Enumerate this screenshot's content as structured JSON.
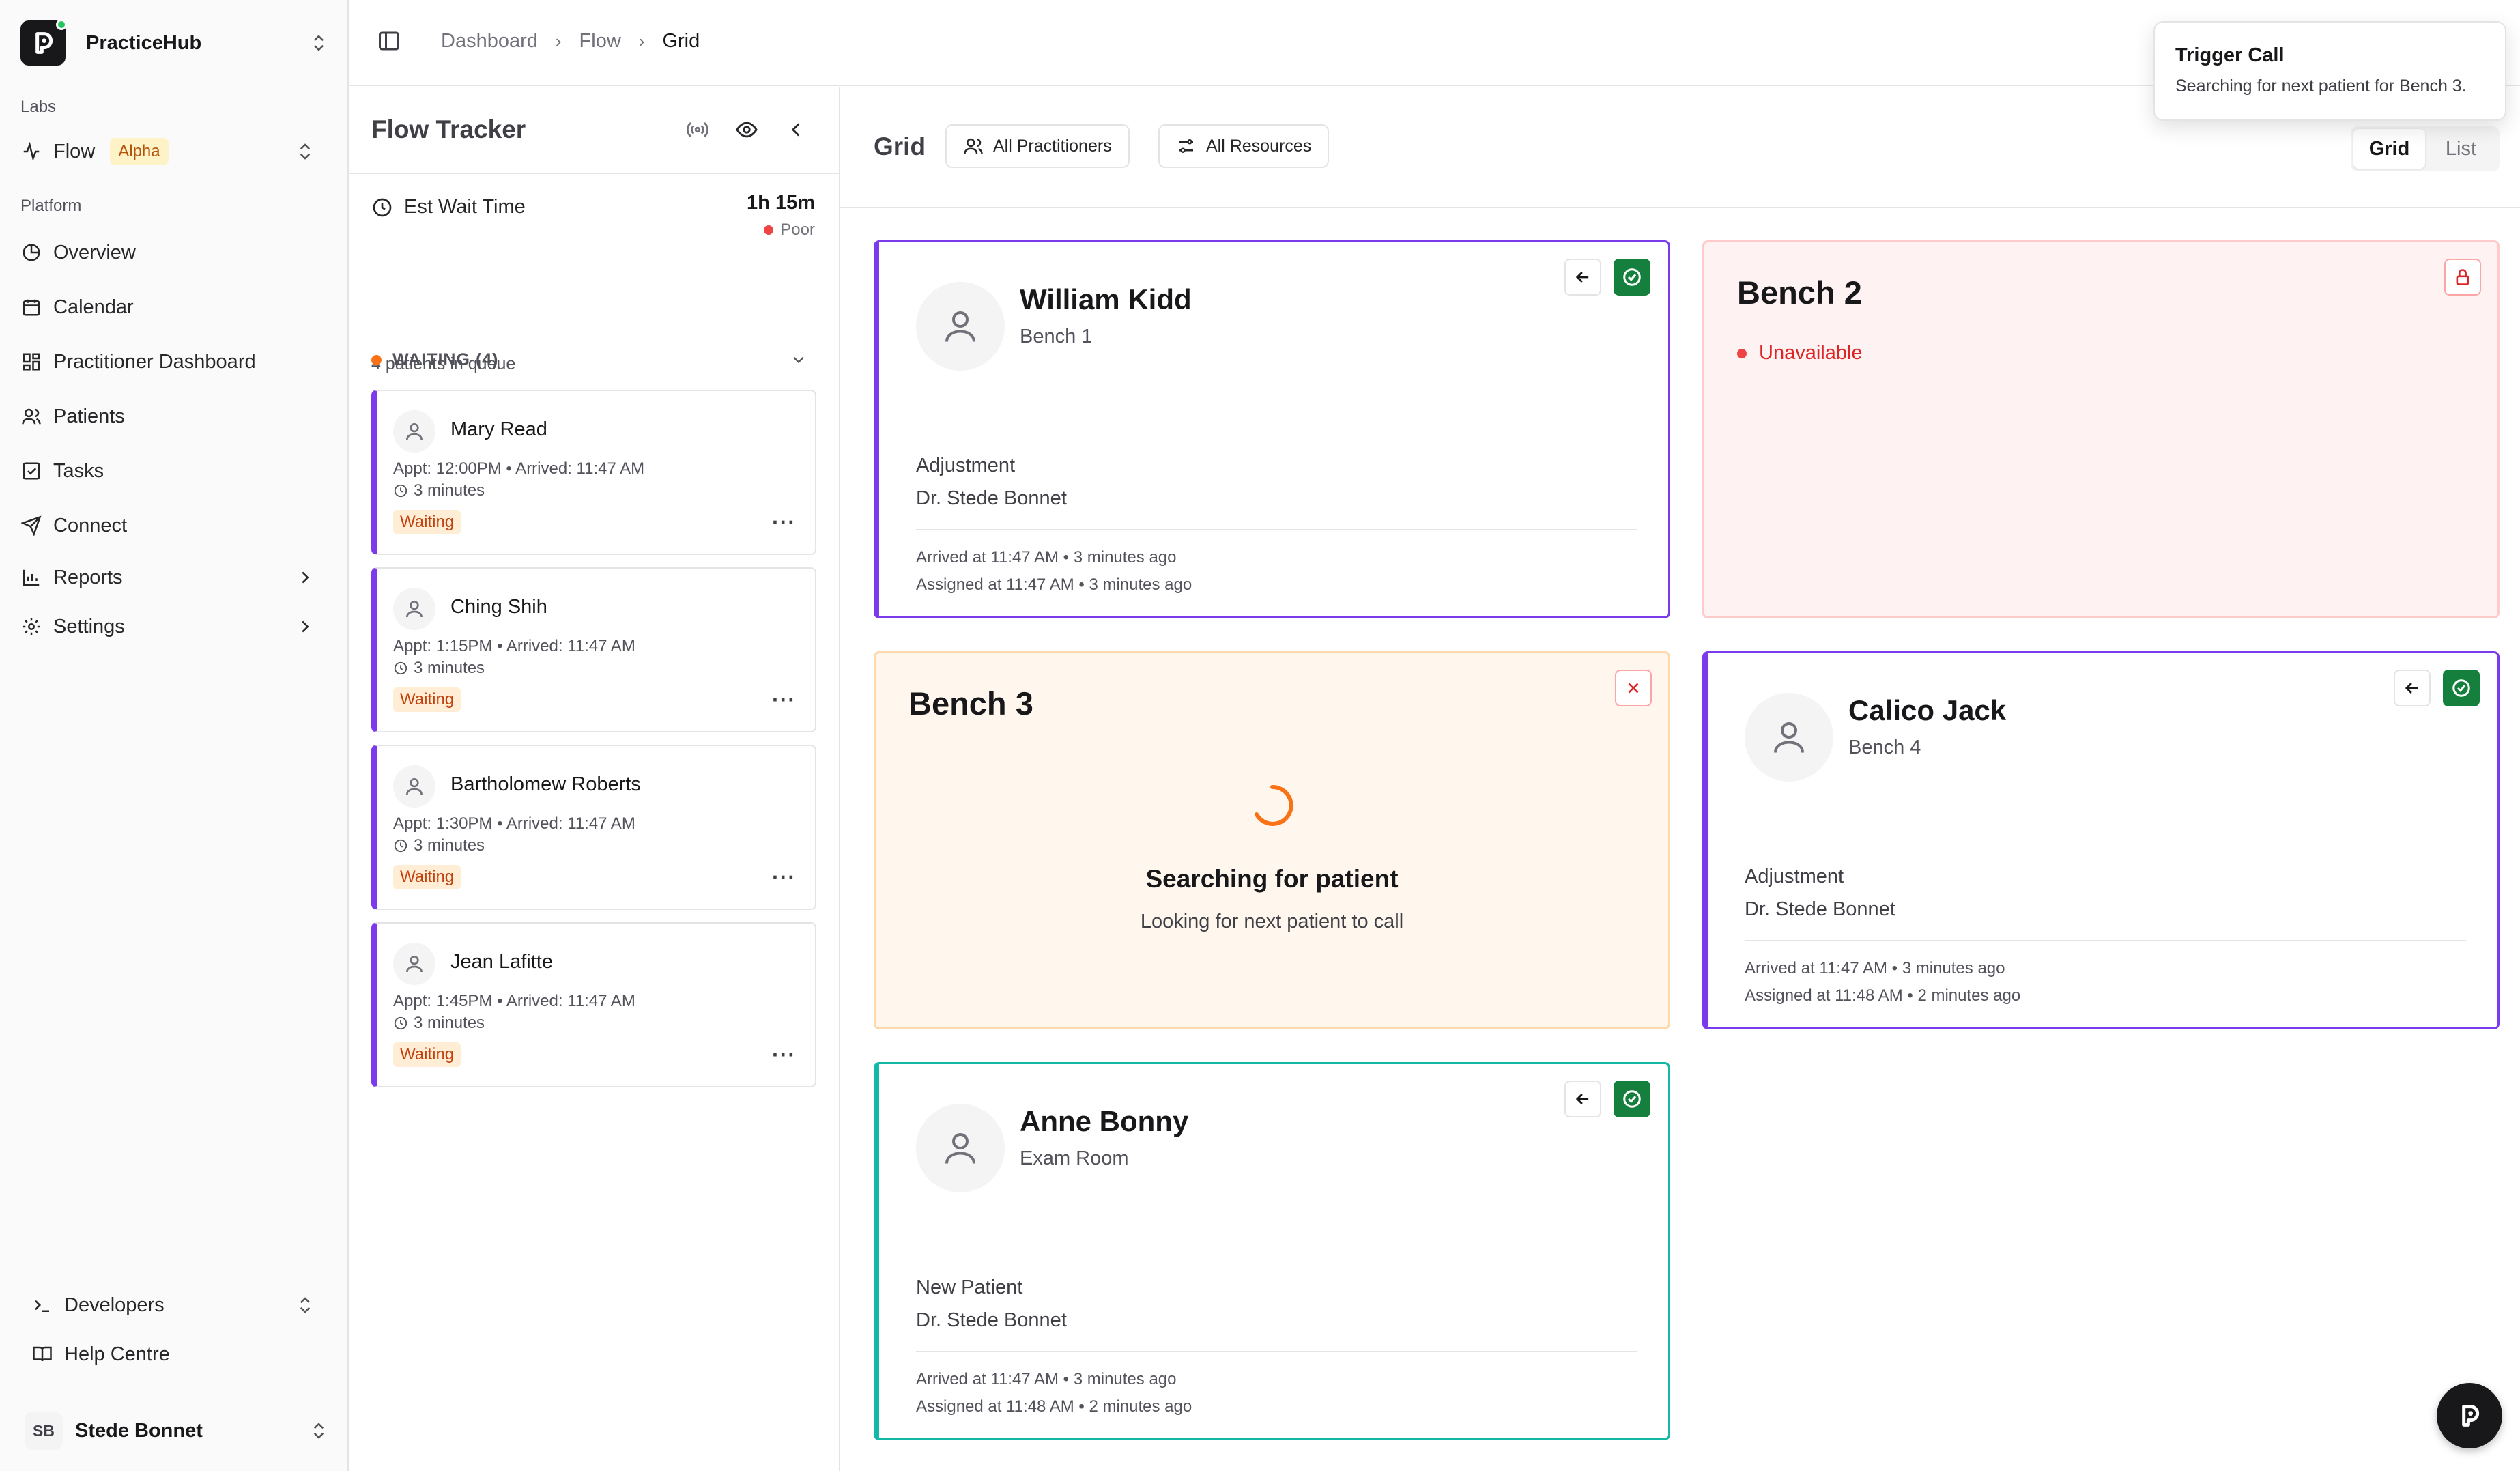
{
  "app": {
    "name": "PracticeHub"
  },
  "sidebar": {
    "labs_label": "Labs",
    "flow": {
      "label": "Flow",
      "badge": "Alpha"
    },
    "platform_label": "Platform",
    "items": [
      {
        "label": "Overview",
        "icon": "overview-icon"
      },
      {
        "label": "Calendar",
        "icon": "calendar-icon"
      },
      {
        "label": "Practitioner Dashboard",
        "icon": "dashboard-icon"
      },
      {
        "label": "Patients",
        "icon": "users-icon"
      },
      {
        "label": "Tasks",
        "icon": "tasks-icon"
      },
      {
        "label": "Connect",
        "icon": "send-icon"
      },
      {
        "label": "Reports",
        "icon": "chart-icon"
      },
      {
        "label": "Settings",
        "icon": "gear-icon"
      }
    ],
    "developers": "Developers",
    "help": "Help Centre",
    "user": {
      "initials": "SB",
      "name": "Stede Bonnet"
    }
  },
  "breadcrumb": [
    "Dashboard",
    "Flow",
    "Grid"
  ],
  "toast": {
    "title": "Trigger Call",
    "message": "Searching for next patient for Bench 3."
  },
  "tracker": {
    "title": "Flow Tracker",
    "wait_label": "Est Wait Time",
    "wait_time": "1h 15m",
    "wait_status": "Poor",
    "queue_text": "4 patients in queue",
    "waiting_header": "WAITING (4)",
    "patients": [
      {
        "name": "Mary Read",
        "appt": "Appt: 12:00PM • Arrived: 11:47 AM",
        "duration": "3 minutes",
        "status": "Waiting"
      },
      {
        "name": "Ching Shih",
        "appt": "Appt: 1:15PM • Arrived: 11:47 AM",
        "duration": "3 minutes",
        "status": "Waiting"
      },
      {
        "name": "Bartholomew Roberts",
        "appt": "Appt: 1:30PM • Arrived: 11:47 AM",
        "duration": "3 minutes",
        "status": "Waiting"
      },
      {
        "name": "Jean Lafitte",
        "appt": "Appt: 1:45PM • Arrived: 11:47 AM",
        "duration": "3 minutes",
        "status": "Waiting"
      }
    ]
  },
  "grid": {
    "title": "Grid",
    "filters": {
      "practitioners": "All Practitioners",
      "resources": "All Resources"
    },
    "views": {
      "grid": "Grid",
      "list": "List"
    },
    "benches": {
      "b1": {
        "name": "William Kidd",
        "location": "Bench 1",
        "type": "Adjustment",
        "doctor": "Dr. Stede Bonnet",
        "arrived": "Arrived at 11:47 AM • 3 minutes ago",
        "assigned": "Assigned at 11:47 AM • 3 minutes ago"
      },
      "b2": {
        "title": "Bench 2",
        "status": "Unavailable"
      },
      "b3": {
        "title": "Bench 3",
        "search_title": "Searching for patient",
        "search_sub": "Looking for next patient to call"
      },
      "b4": {
        "name": "Calico Jack",
        "location": "Bench 4",
        "type": "Adjustment",
        "doctor": "Dr. Stede Bonnet",
        "arrived": "Arrived at 11:47 AM • 3 minutes ago",
        "assigned": "Assigned at 11:48 AM • 2 minutes ago"
      },
      "b5": {
        "name": "Anne Bonny",
        "location": "Exam Room",
        "type": "New Patient",
        "doctor": "Dr. Stede Bonnet",
        "arrived": "Arrived at 11:47 AM • 3 minutes ago",
        "assigned": "Assigned at 11:48 AM • 2 minutes ago"
      }
    }
  },
  "colors": {
    "accent_purple": "#7c3aed",
    "accent_teal": "#14b8a6",
    "success_green": "#15803d",
    "danger_red": "#dc2626",
    "warning_orange": "#f97316"
  }
}
